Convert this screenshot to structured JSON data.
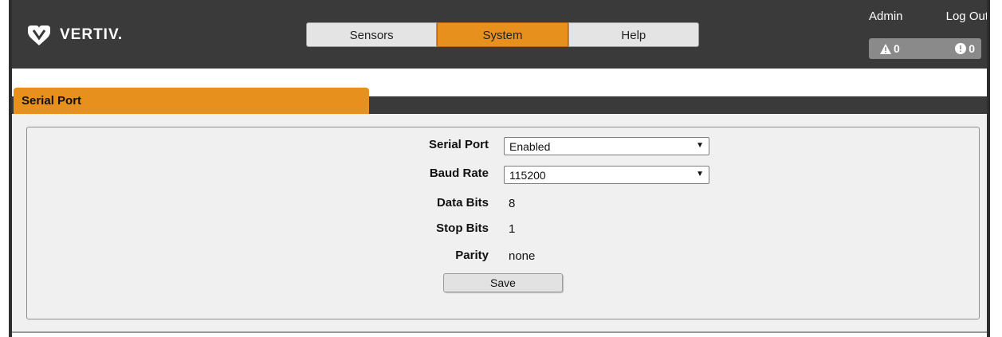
{
  "header": {
    "brand": "VERTIV.",
    "nav_tabs": [
      {
        "label": "Sensors",
        "active": false
      },
      {
        "label": "System",
        "active": true
      },
      {
        "label": "Help",
        "active": false
      }
    ],
    "user_links": {
      "admin": "Admin",
      "logout": "Log Out"
    },
    "alerts": {
      "warning_count": "0",
      "info_count": "0"
    }
  },
  "section": {
    "title": "Serial Port"
  },
  "form": {
    "serial_port": {
      "label": "Serial Port",
      "value": "Enabled"
    },
    "baud_rate": {
      "label": "Baud Rate",
      "value": "115200"
    },
    "data_bits": {
      "label": "Data Bits",
      "value": "8"
    },
    "stop_bits": {
      "label": "Stop Bits",
      "value": "1"
    },
    "parity": {
      "label": "Parity",
      "value": "none"
    },
    "save_label": "Save"
  },
  "colors": {
    "accent": "#e8901e",
    "header_bg": "#3a3a3a",
    "panel_bg": "#f0f0f0"
  }
}
